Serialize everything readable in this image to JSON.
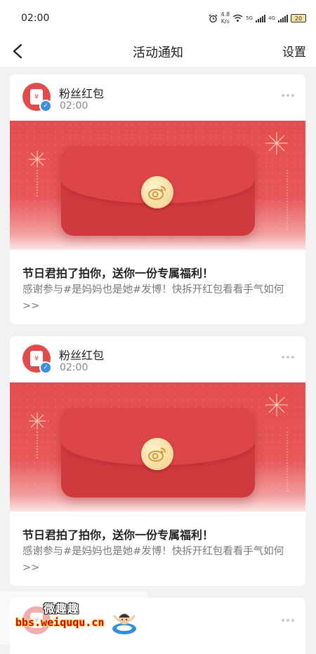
{
  "status_bar": {
    "time": "02:00",
    "speed_value": "4.8",
    "speed_unit": "K/s",
    "network_1": "5G",
    "network_2": "4G",
    "battery": "20"
  },
  "header": {
    "title": "活动通知",
    "settings_label": "设置"
  },
  "notifications": [
    {
      "sender": "粉丝红包",
      "time": "02:00",
      "title": "节日君拍了拍你，送你一份专属福利！",
      "description": "感谢参与#是妈妈也是她#发博！快拆开红包看看手气如何>>"
    },
    {
      "sender": "粉丝红包",
      "time": "02:00",
      "title": "节日君拍了拍你，送你一份专属福利！",
      "description": "感谢参与#是妈妈也是她#发博！快拆开红包看看手气如何>>"
    }
  ],
  "watermark": {
    "title": "微趣趣",
    "url": "bbs.weiququ.cn"
  },
  "colors": {
    "banner_red": "#e34d50",
    "envelope_red": "#cf3a3f",
    "verified_blue": "#3a8fe3"
  }
}
